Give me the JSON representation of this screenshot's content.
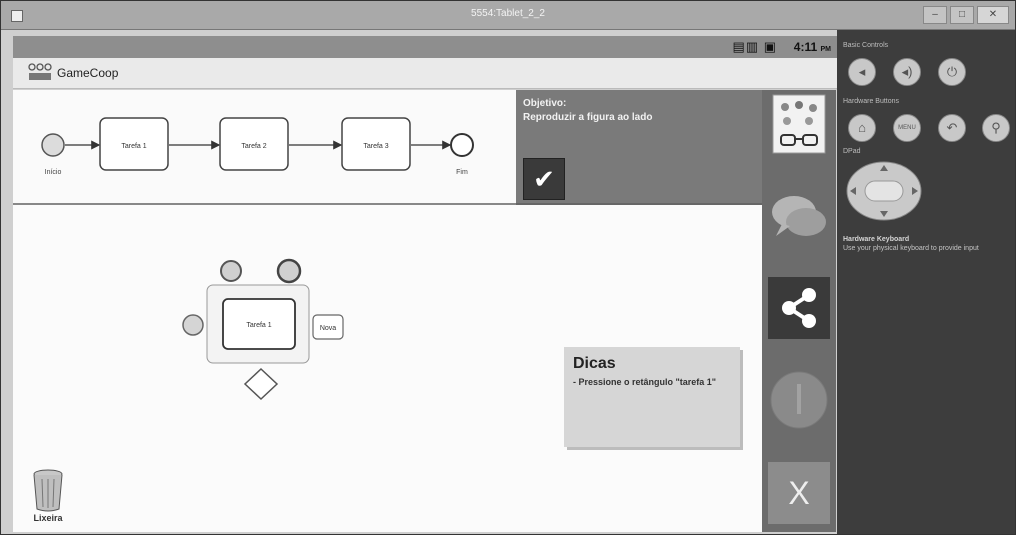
{
  "window": {
    "title": "5554:Tablet_2_2",
    "minimize": "–",
    "maximize": "□",
    "close": "✕"
  },
  "status_bar": {
    "icons": "▤▥ ▣",
    "time": "4:11",
    "ampm": "PM"
  },
  "app": {
    "name": "GameCoop"
  },
  "objective_diagram": {
    "start_label": "Início",
    "tasks": [
      "Tarefa 1",
      "Tarefa 2",
      "Tarefa 3"
    ],
    "end_label": "Fim"
  },
  "goal": {
    "label": "Objetivo:",
    "text": "Reproduzir a figura ao lado",
    "confirm_icon": "check-icon"
  },
  "work_canvas": {
    "task_label": "Tarefa 1",
    "new_label": "Nova"
  },
  "hint": {
    "title": "Dicas",
    "text": "- Pressione o retângulo \"tarefa 1\""
  },
  "trash": {
    "label": "Lixeira"
  },
  "tools": [
    {
      "name": "avatar-tool",
      "icon": "avatar-glasses-icon"
    },
    {
      "name": "chat-tool",
      "icon": "chat-bubbles-icon"
    },
    {
      "name": "share-tool",
      "icon": "share-icon"
    },
    {
      "name": "info-tool",
      "icon": "info-icon"
    },
    {
      "name": "close-tool",
      "label": "X"
    }
  ],
  "emulator_controls": {
    "basic_controls": "Basic Controls",
    "hardware_buttons": "Hardware Buttons",
    "dpad": "DPad",
    "keyboard_title": "Hardware Keyboard",
    "keyboard_text": "Use your physical keyboard to provide input",
    "menu_label": "MENU"
  }
}
